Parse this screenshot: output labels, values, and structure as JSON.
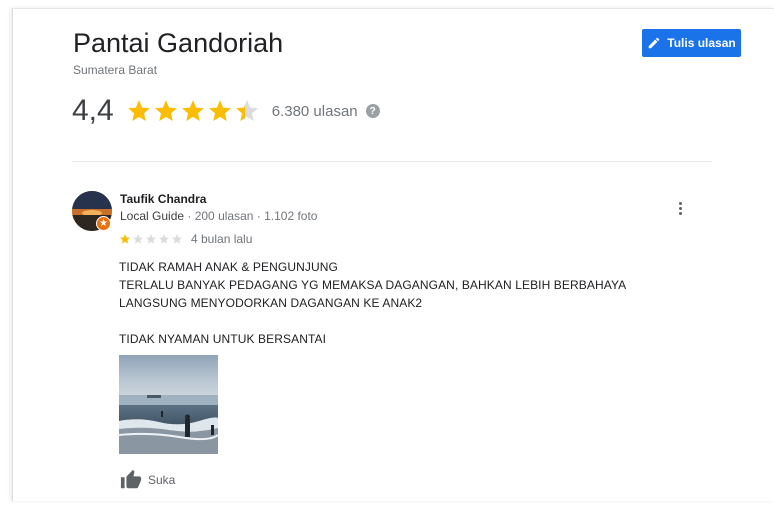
{
  "place": {
    "title": "Pantai Gandoriah",
    "subtitle": "Sumatera Barat",
    "rating": "4,4",
    "rating_value": 4.4,
    "review_count": "6.380 ulasan"
  },
  "actions": {
    "write_review_label": "Tulis ulasan"
  },
  "review": {
    "reviewer_name": "Taufik Chandra",
    "reviewer_meta_guide": "Local Guide",
    "reviewer_meta_stats": " · 200 ulasan · 1.102 foto",
    "stars": 1,
    "time": "4 bulan lalu",
    "text_line1": "TIDAK RAMAH ANAK & PENGUNJUNG",
    "text_line2": "TERLALU BANYAK PEDAGANG YG MEMAKSA DAGANGAN, BAHKAN LEBIH BERBAHAYA",
    "text_line3": "LANGSUNG MENYODORKAN DAGANGAN KE ANAK2",
    "text_line4": "TIDAK NYAMAN UNTUK BERSANTAI",
    "like_label": "Suka"
  },
  "icons": {
    "edit": "pencil-icon",
    "help": "question-icon",
    "more": "more-vert-icon",
    "like": "thumb-up-icon",
    "badge": "local-guide-star-icon"
  },
  "colors": {
    "accent": "#1a73e8",
    "star": "#fbbc04",
    "star_empty": "#dadce0",
    "badge": "#e8710a"
  }
}
